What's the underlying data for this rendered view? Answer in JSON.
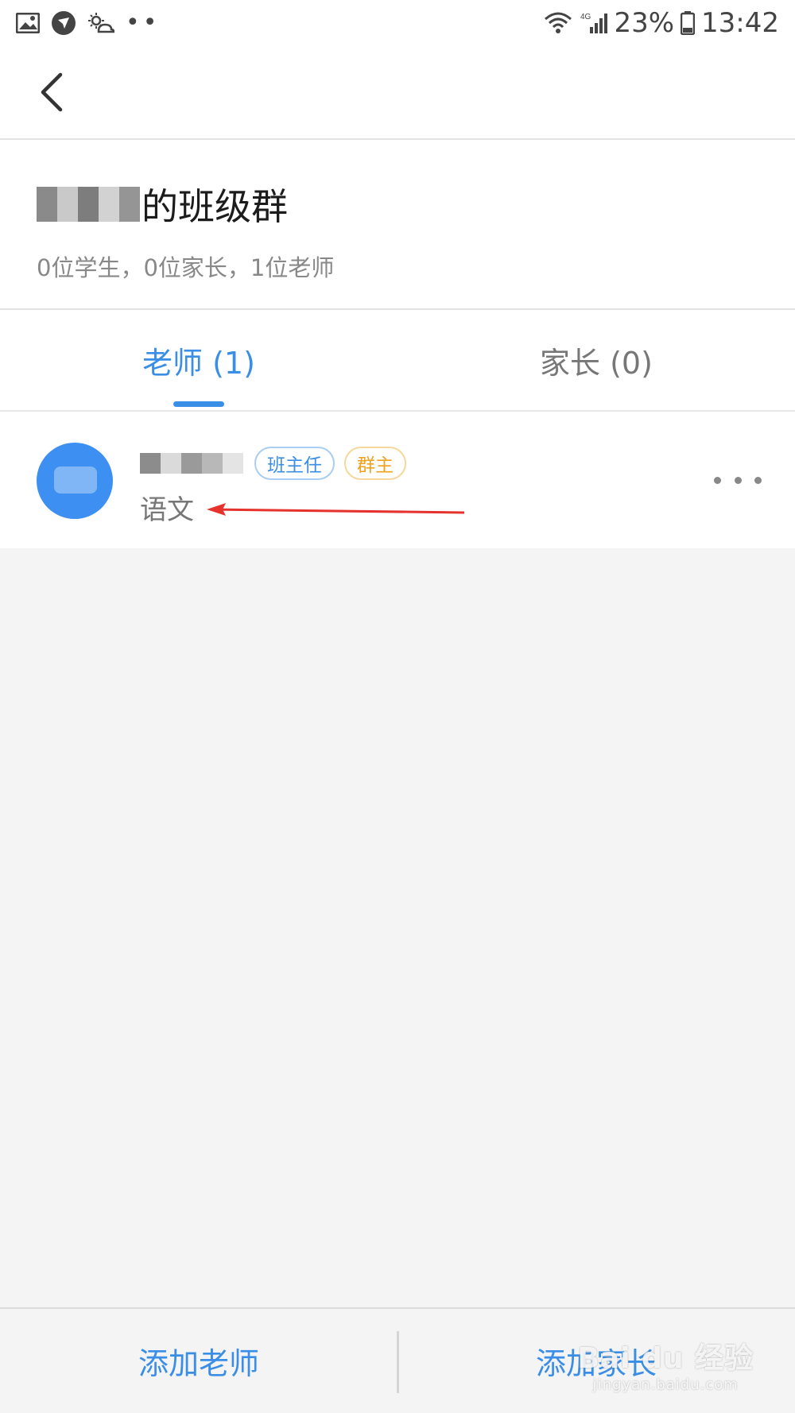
{
  "status_bar": {
    "network": "4G",
    "battery": "23%",
    "time": "13:42",
    "left_icons": [
      "image-icon",
      "app-notification-icon",
      "weather-icon",
      "more-notifications-icon"
    ]
  },
  "group": {
    "title_suffix": "的班级群",
    "summary": "0位学生，0位家长，1位老师"
  },
  "tabs": [
    {
      "label": "老师 (1)",
      "active": true
    },
    {
      "label": "家长 (0)",
      "active": false
    }
  ],
  "members": [
    {
      "badges": [
        "班主任",
        "群主"
      ],
      "subject": "语文"
    }
  ],
  "bottom_bar": {
    "add_teacher": "添加老师",
    "add_parent": "添加家长"
  },
  "watermark": {
    "brand": "Bai du 经验",
    "url": "jingyan.baidu.com"
  },
  "colors": {
    "accent": "#3a8ee6",
    "owner_badge": "#efa21f",
    "avatar": "#3d8ff2",
    "annotation_arrow": "#e5322d"
  }
}
